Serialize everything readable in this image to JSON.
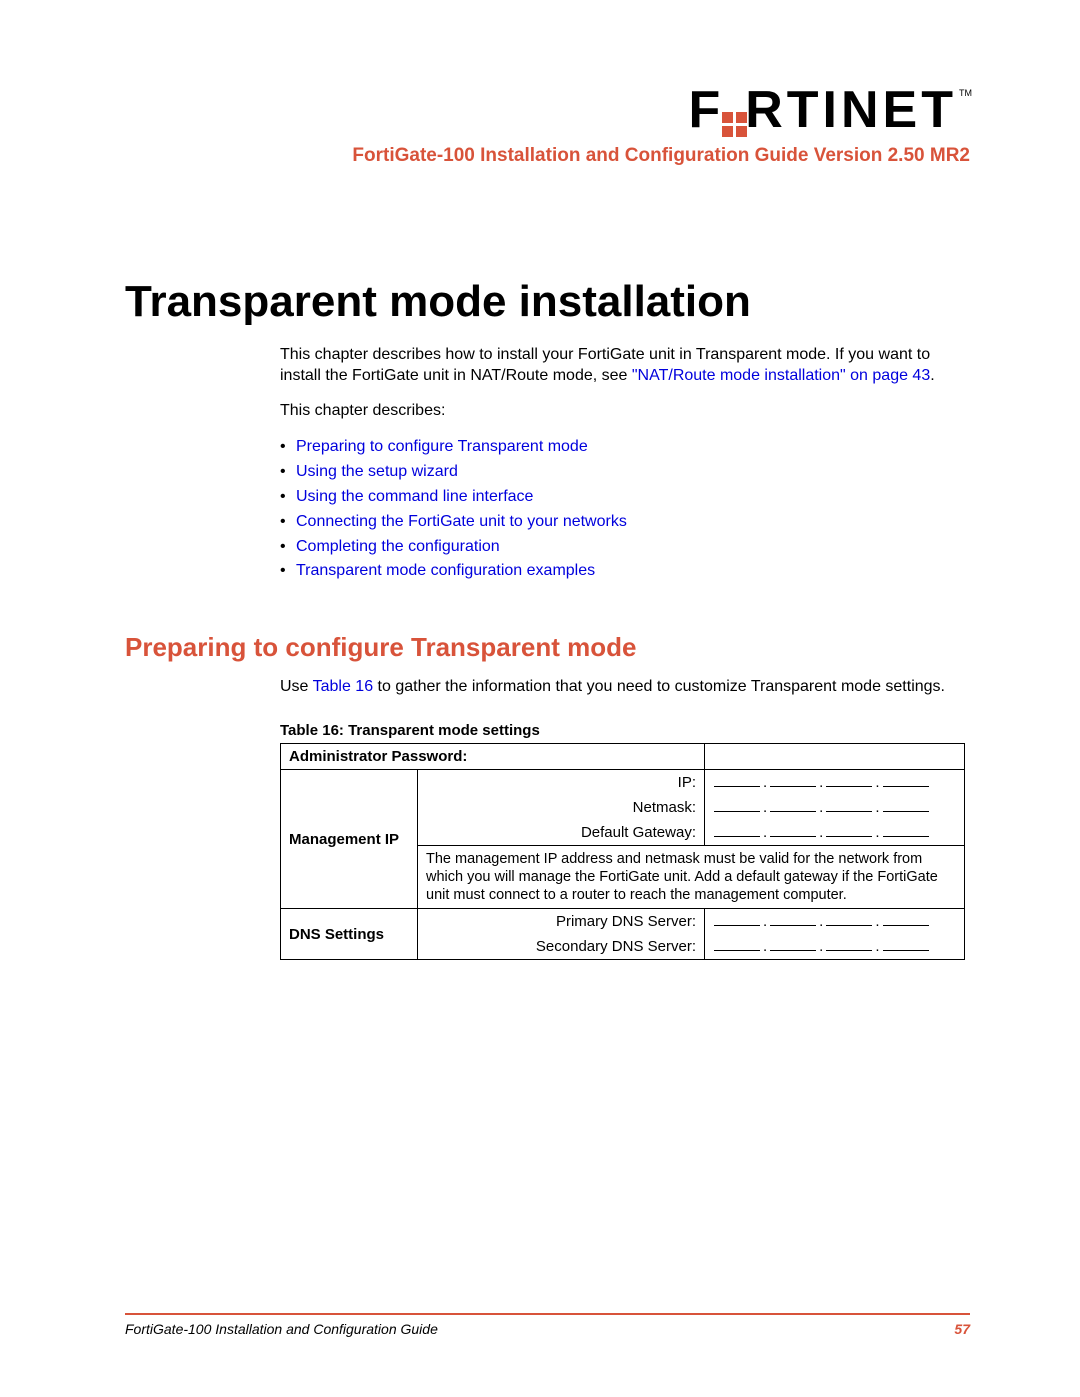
{
  "header": {
    "brand_left": "F",
    "brand_right": "RTINET",
    "tm": "TM",
    "subtitle": "FortiGate-100 Installation and Configuration Guide Version 2.50 MR2"
  },
  "chapter": {
    "title": "Transparent mode installation",
    "intro_a": "This chapter describes how to install your FortiGate unit in Transparent mode. If you want to install the FortiGate unit in NAT/Route mode, see ",
    "intro_link": "\"NAT/Route mode installation\" on page 43",
    "intro_b": ".",
    "describes": "This chapter describes:",
    "toc": [
      "Preparing to configure Transparent mode",
      "Using the setup wizard",
      "Using the command line interface",
      "Connecting the FortiGate unit to your networks",
      "Completing the configuration",
      "Transparent mode configuration examples"
    ]
  },
  "section": {
    "heading": "Preparing to configure Transparent mode",
    "use_a": "Use ",
    "use_link": "Table 16",
    "use_b": " to gather the information that you need to customize Transparent mode settings."
  },
  "table": {
    "caption": "Table 16: Transparent mode settings",
    "admin_password": "Administrator Password:",
    "management_ip": "Management IP",
    "ip": "IP:",
    "netmask": "Netmask:",
    "default_gateway": "Default Gateway:",
    "note": "The management IP address and netmask must be valid for the network from which you will manage the FortiGate unit. Add a default gateway if the FortiGate unit must connect to a router to reach the management computer.",
    "dns_settings": "DNS Settings",
    "primary_dns": "Primary DNS Server:",
    "secondary_dns": "Secondary DNS Server:"
  },
  "footer": {
    "left": "FortiGate-100 Installation and Configuration Guide",
    "page": "57"
  }
}
